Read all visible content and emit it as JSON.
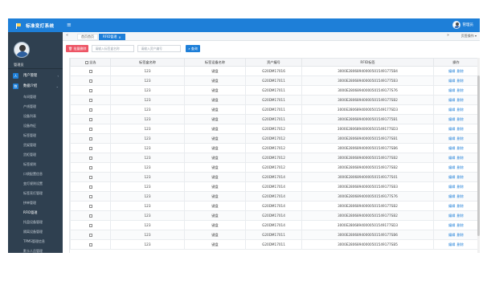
{
  "app": {
    "title": "标准变灯系统",
    "menu_icon": "hamburger-icon"
  },
  "header": {
    "user_name": "管理员"
  },
  "sidebar": {
    "user_name": "管理员",
    "groups": [
      {
        "label": "用户管理",
        "icon": "user-icon"
      },
      {
        "label": "数据介绍",
        "icon": "data-icon"
      }
    ],
    "items": [
      {
        "label": "车间管理"
      },
      {
        "label": "产线管理"
      },
      {
        "label": "设备列表"
      },
      {
        "label": "设备特征"
      },
      {
        "label": "标签管理"
      },
      {
        "label": "货架管理"
      },
      {
        "label": "货柜管理"
      },
      {
        "label": "标签规则"
      },
      {
        "label": "口袋配置信息"
      },
      {
        "label": "变灯规则设置"
      },
      {
        "label": "标签亮灯管理"
      },
      {
        "label": "拼单管理"
      },
      {
        "label": "RFID管理"
      },
      {
        "label": "托盘设备管理"
      },
      {
        "label": "隔离设备管理"
      },
      {
        "label": "TPMS管理信息"
      },
      {
        "label": "默卡人员管理"
      }
    ]
  },
  "tabs": {
    "items": [
      {
        "label": "首页首页",
        "active": false
      },
      {
        "label": "RFID管理",
        "active": true
      }
    ],
    "close_symbol": "×",
    "ops_label": "页签操作 ▾"
  },
  "toolbar": {
    "delete_label": "批量删除",
    "input1_placeholder": "请输入标签盒名称",
    "input2_placeholder": "请输入资产编号",
    "search_label": "查询"
  },
  "table": {
    "columns": [
      "全选",
      "标签盒名称",
      "标签设备名称",
      "资产编号",
      "RFID标签",
      "操作"
    ],
    "actions": {
      "edit": "编辑",
      "delete": "删除"
    },
    "rows": [
      {
        "box": "123",
        "device": "键盘",
        "asset": "G20DM17016",
        "rfid": "3000E280689400005015491775B4"
      },
      {
        "box": "123",
        "device": "键盘",
        "asset": "G20DM17011",
        "rfid": "3000E280689400005015491775B3"
      },
      {
        "box": "123",
        "device": "键盘",
        "asset": "G20DM17011",
        "rfid": "3000E28068940000501549177S76"
      },
      {
        "box": "123",
        "device": "键盘",
        "asset": "G20DM17011",
        "rfid": "3000E28068940000501549177SB2"
      },
      {
        "box": "123",
        "device": "键盘",
        "asset": "G20DM17011",
        "rfid": "3000E28068940000501549177SD3"
      },
      {
        "box": "123",
        "device": "键盘",
        "asset": "G20DM17011",
        "rfid": "3000E280689400005015491775B1"
      },
      {
        "box": "123",
        "device": "键盘",
        "asset": "G20DM17012",
        "rfid": "3000E28068940000501549177SD3"
      },
      {
        "box": "123",
        "device": "键盘",
        "asset": "G20DM17012",
        "rfid": "3000E28068940000501549177SB1"
      },
      {
        "box": "123",
        "device": "键盘",
        "asset": "G20DM17012",
        "rfid": "3000E28068940000501549177SB6"
      },
      {
        "box": "123",
        "device": "键盘",
        "asset": "G20DM17012",
        "rfid": "3000E28068940000501549177SB2"
      },
      {
        "box": "123",
        "device": "键盘",
        "asset": "G20DM17012",
        "rfid": "3000E28068940000501549177SB2"
      },
      {
        "box": "123",
        "device": "键盘",
        "asset": "G20DM17014",
        "rfid": "3000E28068940000501549177S01"
      },
      {
        "box": "123",
        "device": "键盘",
        "asset": "G20DM17014",
        "rfid": "3000E28068940000501549177SB3"
      },
      {
        "box": "123",
        "device": "键盘",
        "asset": "G20DM17014",
        "rfid": "3000E28068940000501549177S76"
      },
      {
        "box": "123",
        "device": "键盘",
        "asset": "G20DM17014",
        "rfid": "3000E28068940000501549177SB2"
      },
      {
        "box": "123",
        "device": "键盘",
        "asset": "G20DM17014",
        "rfid": "3000E28068940000501549177SB2"
      },
      {
        "box": "123",
        "device": "键盘",
        "asset": "G20DM17014",
        "rfid": "3000E28068940000501549177SD3"
      },
      {
        "box": "123",
        "device": "键盘",
        "asset": "G20DM17011",
        "rfid": "3000E28068940000501549177SB6"
      },
      {
        "box": "123",
        "device": "键盘",
        "asset": "G20DM17011",
        "rfid": "3000E28068940000501549177SB5"
      }
    ]
  },
  "colors": {
    "primary": "#1e7fd8",
    "sidebar": "#2f4050",
    "danger": "#ed5565"
  }
}
